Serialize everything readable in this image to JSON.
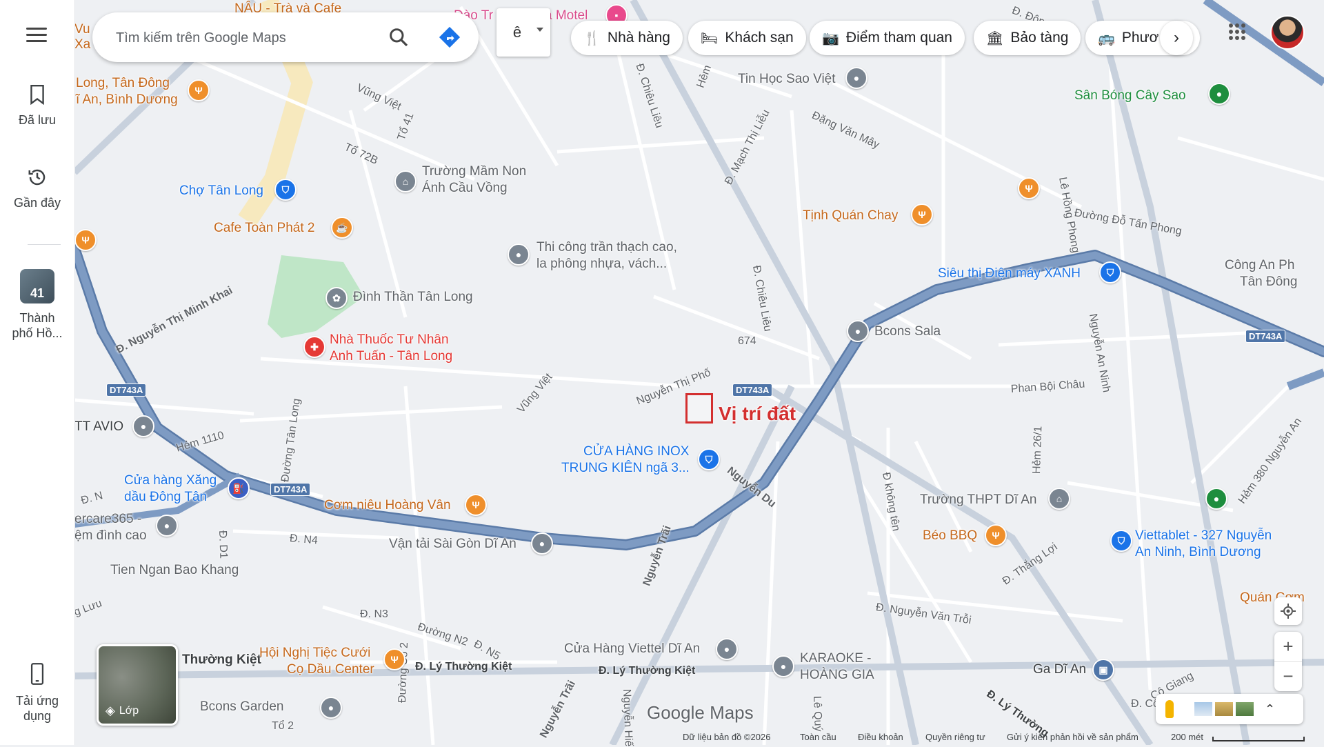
{
  "sidebar": {
    "saved_label": "Đã lưu",
    "recent_label": "Gần đây",
    "city_label_line1": "Thành",
    "city_label_line2": "phố Hồ...",
    "city_badge": "41",
    "download_line1": "Tải ứng",
    "download_line2": "dụng"
  },
  "search": {
    "placeholder": "Tìm kiếm trên Google Maps",
    "dropdown_char": "ê"
  },
  "chips": [
    {
      "label": "Nhà hàng",
      "icon": "fork-knife-icon"
    },
    {
      "label": "Khách sạn",
      "icon": "bed-icon"
    },
    {
      "label": "Điểm tham quan",
      "icon": "camera-icon"
    },
    {
      "label": "Bảo tàng",
      "icon": "museum-icon"
    },
    {
      "label": "Phươ",
      "icon": "bus-icon"
    }
  ],
  "poi": {
    "nau": "NÂU - Trà và Cafe",
    "motel": "a Motel",
    "dao_tr": "Đào Tr",
    "long_tan_dong_1": "Long, Tân Đông",
    "long_tan_dong_2": "ĩ An, Bình Dương",
    "vu": "Vu",
    "xa": "Xa",
    "tin_hoc": "Tin Học Sao Việt",
    "san_bong": "Sân Bóng Cây Sao",
    "truong_mam_non_1": "Trường Mầm Non",
    "truong_mam_non_2": "Ánh Cầu Vồng",
    "cho_tan_long": "Chợ Tân Long",
    "cafe_toan_phat": "Cafe Toàn Phát 2",
    "tinh_quan_chay": "Tịnh Quán Chay",
    "thi_cong_1": "Thi công trần thạch cao,",
    "thi_cong_2": "la phông nhựa, vách...",
    "dinh_than": "Đình Thần Tân Long",
    "sieu_thi": "Siêu thị Điện máy XANH",
    "cong_an_1": "Công An Ph",
    "cong_an_2": "Tân Đông",
    "nha_thuoc_1": "Nhà Thuốc Tư Nhân",
    "nha_thuoc_2": "Anh Tuấn - Tân Long",
    "bcons_sala": "Bcons Sala",
    "vi_tri_dat": "Vị trí đất",
    "tt_avio": "TT AVIO",
    "cua_hang_inox_1": "CỬA HÀNG INOX",
    "cua_hang_inox_2": "TRUNG KIÊN ngã 3...",
    "cua_hang_xang_1": "Cửa hàng Xăng",
    "cua_hang_xang_2": "dầu Đông Tân",
    "com_nieu": "Cơm niêu Hoàng Vân",
    "truong_thpt": "Trường THPT Dĩ An",
    "ercare_1": "ercare365 -",
    "ercare_2": "ệm đình cao",
    "beo_bbq": "Béo BBQ",
    "van_tai": "Vận tải Sài Gòn Dĩ An",
    "viettablet_1": "Viettablet - 327 Nguyễn",
    "viettablet_2": "An Ninh, Bình Dương",
    "tien_ngan": "Tien Ngan Bao Khang",
    "quan_com": "Quán Cơm",
    "thuong_kiet": "Thường Kiệt",
    "hoi_nghi_1": "Hội Nghị Tiệc Cưới",
    "hoi_nghi_2": "Cọ Dầu Center",
    "cua_hang_viettel": "Cửa Hàng Viettel Dĩ An",
    "karaoke_1": "KARAOKE -",
    "karaoke_2": "HOÀNG GIA",
    "ga_di_an": "Ga Dĩ An",
    "bcons_garden": "Bcons Garden"
  },
  "streets": {
    "d_dong_tha": "Đ. Đông Thạ",
    "vung_viet_1": "Vũng Việt",
    "to_41": "Tổ 41",
    "to_72b": "Tổ 72B",
    "chieu_lieu_1": "Đ. Chiêu Liêu",
    "hem_top": "Hẻm",
    "mach_thi_lieu": "Đ. Mạch Thị Liễu",
    "dang_van_may": "Đặng Văn Mây",
    "le_hong_phong": "Lê Hồng Phong",
    "duong_do_tan_phong": "Đường Đỗ Tấn Phong",
    "nguyen_thi_minh_khai": "Đ. Nguyễn Thị Minh Khai",
    "chieu_lieu_2": "Đ. Chiêu Liêu",
    "n674": "674",
    "vung_viet_2": "Vũng Việt",
    "nguyen_thi_pho": "Nguyễn Thị Phố",
    "phan_boi_chau": "Phan Bội Châu",
    "nguyen_an_ninh": "Nguyễn An Ninh",
    "hem_1110": "Hẻm 1110",
    "duong_tan_long": "Đường Tân Long",
    "hem_26_1": "Hẻm 26/1",
    "hem_380": "Hẻm 380 Nguyễn An",
    "nguyen_du": "Nguyễn Du",
    "d_khong_ten": "Đ không tên",
    "d_n": "Đ. N",
    "d_d1": "Đ. D1",
    "d_n4": "Đ. N4",
    "nguyen_trai_1": "Nguyễn Trãi",
    "d_thang_loi": "Đ. Thắng Lợi",
    "d_n3": "Đ. N3",
    "duong_n2": "Đường N2",
    "d_n5": "Đ. N5",
    "d_nguyen_van_troi": "Đ. Nguyễn Văn Trỗi",
    "ly_thuong_kiet_1": "Đ. Lý Thường Kiệt",
    "ly_thuong_kiet_2": "Đ. Lý Thường Kiệt",
    "ly_thuong_kiet_3": "Đ. Lý Thường",
    "nguyen_trai_2": "Nguyễn Trãi",
    "nguyen_hie": "Nguyễn Hiế",
    "le_quy": "Lê Quý",
    "co_giang": "Cô Giang",
    "d_co_b": "Đ. Cô B",
    "duong_so_2": "Đường Số 2",
    "to_2": "Tổ 2",
    "g_lru": "g Lưu",
    "d_n_left": "Đ. N"
  },
  "shields": [
    "DT743A",
    "DT743A",
    "DT743A",
    "DT743A"
  ],
  "layer": {
    "label": "Lớp"
  },
  "footer": {
    "data": "Dữ liệu bản đồ ©2026",
    "global": "Toàn cầu",
    "terms": "Điều khoản",
    "privacy": "Quyền riêng tư",
    "feedback": "Gửi ý kiến phản hồi về sản phẩm",
    "scale": "200 mét"
  },
  "brand": "Google Maps",
  "colors": {
    "road_main": "#7e9bc3",
    "road_casing": "#5b7ba8",
    "restaurant": "#ef8f2b",
    "shopping": "#1a73e8",
    "generic": "#7a8591",
    "park": "#34a853",
    "health": "#e53935",
    "marker": "#d32f2f",
    "lodging": "#e9498c"
  }
}
